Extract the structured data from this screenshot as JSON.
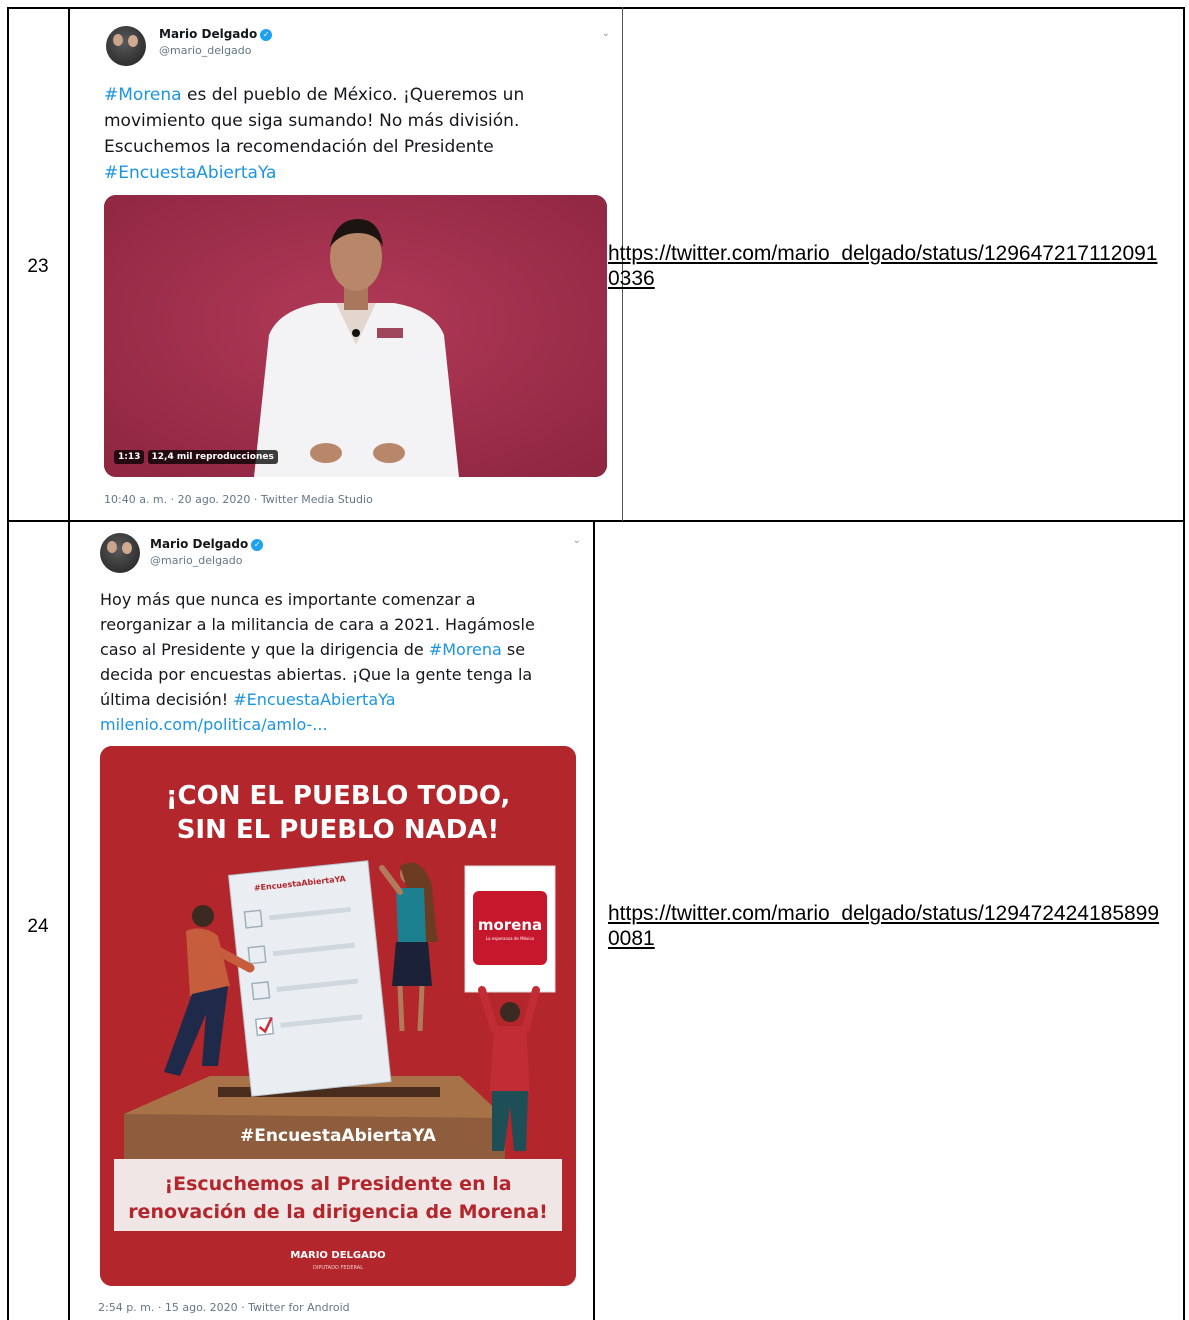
{
  "rows": [
    {
      "number": "23",
      "link": "https://twitter.com/mario_delgado/status/1296472171120910336",
      "tweet": {
        "name": "Mario Delgado",
        "handle": "@mario_delgado",
        "text_parts": [
          "#Morena",
          " es del pueblo de México. ¡Queremos un movimiento que siga sumando! No más división. Escuchemos la recomendación del Presidente ",
          "#EncuestaAbiertaYa"
        ],
        "video_duration": "1:13",
        "video_views": "12,4 mil reproducciones",
        "timestamp": "10:40 a. m. · 20 ago. 2020 · Twitter Media Studio"
      }
    },
    {
      "number": "24",
      "link": "https://twitter.com/mario_delgado/status/1294724241858990081",
      "tweet": {
        "name": "Mario Delgado",
        "handle": "@mario_delgado",
        "text_parts": [
          "Hoy más que nunca es importante comenzar a reorganizar a la militancia de cara a 2021. Hagámosle caso al Presidente y que la dirigencia de ",
          "#Morena",
          " se decida por encuestas abiertas. ¡Que la gente tenga la última decisión! ",
          "#EncuestaAbiertaYa",
          "milenio.com/politica/amlo-..."
        ],
        "poster": {
          "headline_1": "¡CON EL PUEBLO TODO,",
          "headline_2": "SIN EL PUEBLO NADA!",
          "ballot_tag": "#EncuestaAbiertaYA",
          "logo_text": "morena",
          "logo_sub": "La esperanza de México",
          "hashtag": "#EncuestaAbiertaYA",
          "banner_1": "¡Escuchemos al Presidente en la",
          "banner_2": "renovación de la dirigencia de Morena!",
          "signature": "MARIO DELGADO",
          "signature_sub": "DIPUTADO FEDERAL"
        },
        "timestamp": "2:54 p. m. · 15 ago. 2020 · Twitter for Android"
      }
    }
  ],
  "colors": {
    "link_blue": "#1b95e0",
    "video_bg": "#a32e4c",
    "poster_bg": "#b3262c"
  }
}
